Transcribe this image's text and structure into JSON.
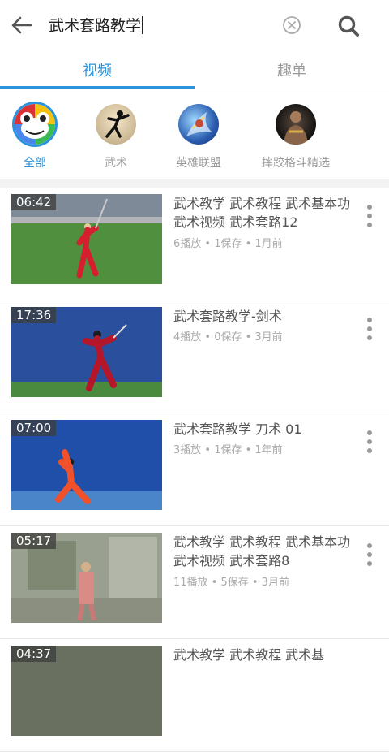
{
  "search": {
    "query": "武术套路教学"
  },
  "tabs": [
    {
      "label": "视频"
    },
    {
      "label": "趣单"
    }
  ],
  "categories": [
    {
      "label": "全部",
      "icon": "frog-logo-icon"
    },
    {
      "label": "武术",
      "icon": "martial-arts-icon"
    },
    {
      "label": "英雄联盟",
      "icon": "league-of-legends-icon"
    },
    {
      "label": "摔跤格斗精选",
      "icon": "wrestling-icon"
    }
  ],
  "videos": [
    {
      "duration": "06:42",
      "title": "武术教学 武术教程 武术基本功 武术视频 武术套路12",
      "meta": "6播放 • 1保存 • 1月前"
    },
    {
      "duration": "17:36",
      "title": "武术套路教学-剑术",
      "meta": "4播放 • 0保存 • 3月前"
    },
    {
      "duration": "07:00",
      "title": "武术套路教学 刀术 01",
      "meta": "3播放 • 1保存 • 1年前"
    },
    {
      "duration": "05:17",
      "title": "武术教学 武术教程 武术基本功 武术视频 武术套路8",
      "meta": "11播放 • 5保存 • 3月前"
    },
    {
      "duration": "04:37",
      "title": "武术教学 武术教程 武术基",
      "meta": ""
    }
  ],
  "colors": {
    "accent": "#2b93dc",
    "muted": "#999999"
  }
}
